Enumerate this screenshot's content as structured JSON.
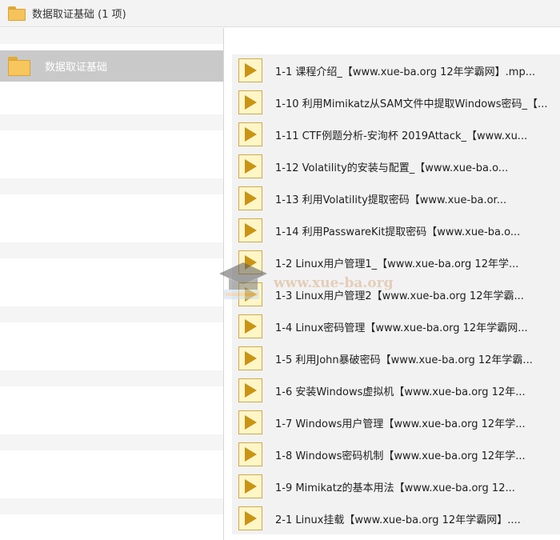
{
  "window": {
    "title": "数据取证基础 (1 项)"
  },
  "tree": {
    "selected_folder": "数据取证基础"
  },
  "files": [
    "1-1 课程介绍_【www.xue-ba.org 12年学霸网】.mp...",
    "1-10 利用Mimikatz从SAM文件中提取Windows密码_【...",
    "1-11 CTF例题分析-安洵杯 2019Attack_【www.xu...",
    "1-12 Volatility的安装与配置_【www.xue-ba.o...",
    "1-13 利用Volatility提取密码【www.xue-ba.or...",
    "1-14 利用PasswareKit提取密码【www.xue-ba.o...",
    "1-2 Linux用户管理1_【www.xue-ba.org 12年学...",
    "1-3 Linux用户管理2【www.xue-ba.org 12年学霸...",
    "1-4 Linux密码管理【www.xue-ba.org 12年学霸网...",
    "1-5 利用John暴破密码【www.xue-ba.org 12年学霸...",
    "1-6 安装Windows虚拟机【www.xue-ba.org 12年...",
    "1-7 Windows用户管理【www.xue-ba.org 12年学...",
    "1-8 Windows密码机制【www.xue-ba.org 12年学...",
    "1-9 Mimikatz的基本用法【www.xue-ba.org 12...",
    "2-1 Linux挂载【www.xue-ba.org 12年学霸网】...."
  ],
  "watermark": {
    "text": "www.xue-ba.org"
  },
  "icons": {
    "folder": "folder-icon",
    "video": "video-file-icon",
    "watermark": "mortarboard-icon"
  },
  "colors": {
    "folder": "#f6c35a",
    "video_icon": "#c99413",
    "selection": "#c9c9c9"
  }
}
